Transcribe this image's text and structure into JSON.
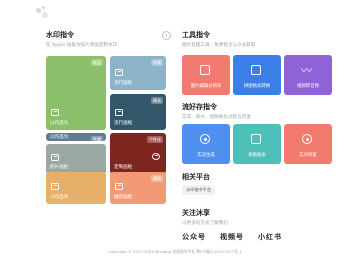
{
  "watermark": {
    "title": "水印指令",
    "subtitle": "在 Apple 设备为照片添加定制水印",
    "tiles": [
      {
        "label": "以作品为",
        "badge": "新品",
        "color": "#8bbf6a"
      },
      {
        "label": "流行画框",
        "badge": "特惠",
        "color": "#8cb3c8"
      },
      {
        "label": "流行画框",
        "badge": "精选",
        "color": "#34566a"
      },
      {
        "label": "以作品为",
        "badge": "专属",
        "color": "#5b7f92"
      },
      {
        "label": "胶片画框",
        "badge": "",
        "color": "#9aa7a3"
      },
      {
        "label": "定制画框",
        "badge": "个性化",
        "color": "#7d2620"
      },
      {
        "label": "以作品为",
        "badge": "",
        "color": "#e7b06a"
      },
      {
        "label": "推荐画框",
        "badge": "爆款",
        "color": "#f29a75"
      }
    ]
  },
  "tools": {
    "title": "工具指令",
    "subtitle": "图片处理工具 - 免费指令公众号获取",
    "tiles": [
      {
        "label": "图片编辑分辨率",
        "color": "#f07b6e",
        "icon": "grid-icon"
      },
      {
        "label": "拼图格式转换",
        "color": "#3d7fe8",
        "icon": "image-icon"
      },
      {
        "label": "视频转音频",
        "color": "#8e63d8",
        "icon": "audio-wave-icon"
      }
    ]
  },
  "popular": {
    "title": "流好存指令",
    "subtitle": "实况、照片、视频备份过程与历里",
    "tiles": [
      {
        "label": "实况生成",
        "color": "#4e8ff0",
        "icon": "target-icon"
      },
      {
        "label": "相册备份",
        "color": "#4fc0b9",
        "icon": "archive-icon"
      },
      {
        "label": "实况恢复",
        "color": "#f07b6e",
        "icon": "target-icon"
      }
    ]
  },
  "related": {
    "title": "相关平台",
    "chip": "水印指令平台"
  },
  "follow": {
    "title": "关注沐享",
    "subtitle": "以更多的方式了解我们",
    "qr_labels": [
      "公众号",
      "视频号",
      "小红书"
    ]
  },
  "footer": "Copyright © 2017-2024 Muxiang 沐享指令平台   粤ICP备2023123417号-1"
}
